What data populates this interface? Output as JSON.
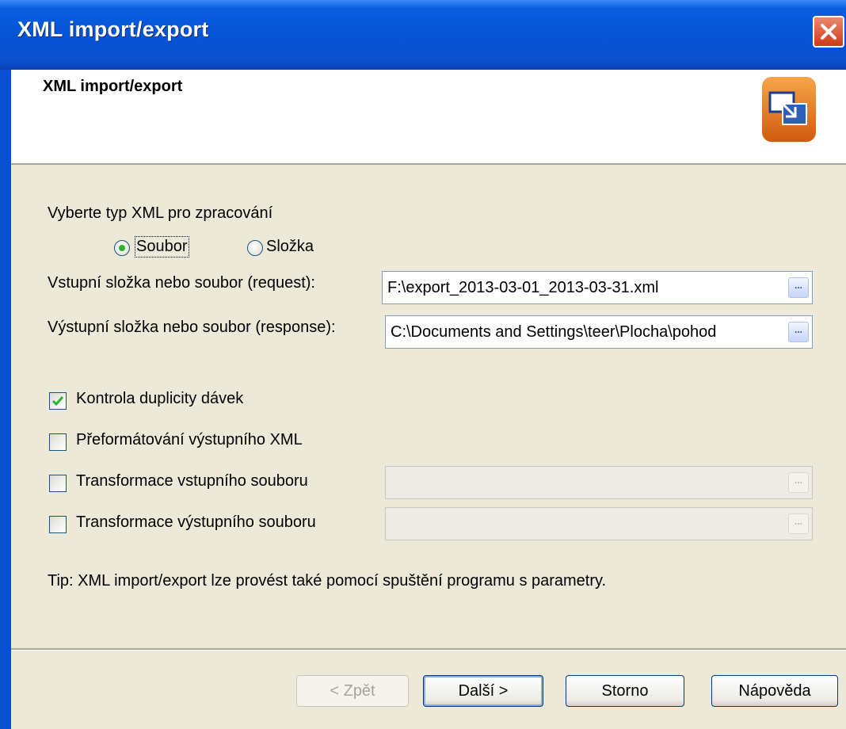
{
  "window": {
    "title": "XML import/export"
  },
  "header": {
    "title": "XML import/export",
    "logo_icon": "xml-transfer-logo"
  },
  "type_select": {
    "label": "Vyberte typ XML pro zpracování",
    "options": [
      {
        "label": "Soubor",
        "selected": true
      },
      {
        "label": "Složka",
        "selected": false
      }
    ]
  },
  "input_path": {
    "label": "Vstupní složka nebo soubor (request):",
    "value": "F:\\export_2013-03-01_2013-03-31.xml",
    "browse": "..."
  },
  "output_path": {
    "label": "Výstupní složka nebo soubor (response):",
    "value": "C:\\Documents and Settings\\teer\\Plocha\\pohod",
    "browse": "..."
  },
  "options": [
    {
      "label": "Kontrola duplicity dávek",
      "checked": true
    },
    {
      "label": "Přeformátování výstupního XML",
      "checked": false
    },
    {
      "label": "Transformace vstupního souboru",
      "checked": false,
      "value": ""
    },
    {
      "label": "Transformace výstupního souboru",
      "checked": false,
      "value": ""
    }
  ],
  "tip": "Tip: XML import/export lze provést také pomocí spuštění programu s parametry.",
  "buttons": {
    "back": "< Zpět",
    "next": "Další >",
    "cancel": "Storno",
    "help": "Nápověda"
  },
  "colors": {
    "titlebar": "#0554d6",
    "dialog_bg": "#ece9d8",
    "radio_dot": "#2fb12f",
    "check_mark": "#2fb12f"
  }
}
